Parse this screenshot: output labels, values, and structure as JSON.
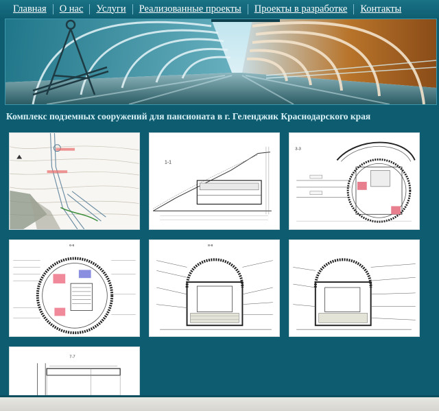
{
  "nav": {
    "items": [
      {
        "label": "Главная"
      },
      {
        "label": "О нас"
      },
      {
        "label": "Услуги"
      },
      {
        "label": "Реализованные проекты"
      },
      {
        "label": "Проекты в разработке"
      },
      {
        "label": "Контакты"
      }
    ]
  },
  "page": {
    "title": "Комплекс подземных сооружений для пансионата в г. Геленджик Краснодарского края"
  },
  "gallery": {
    "captions": [
      "1-1",
      "3-3",
      "6-6",
      "8-8",
      "7-7"
    ]
  },
  "colors": {
    "background": "#0d5c6f",
    "nav_bg": "#1a7285",
    "title_text": "#d8f1f7",
    "thumb_bg": "#ffffff"
  }
}
